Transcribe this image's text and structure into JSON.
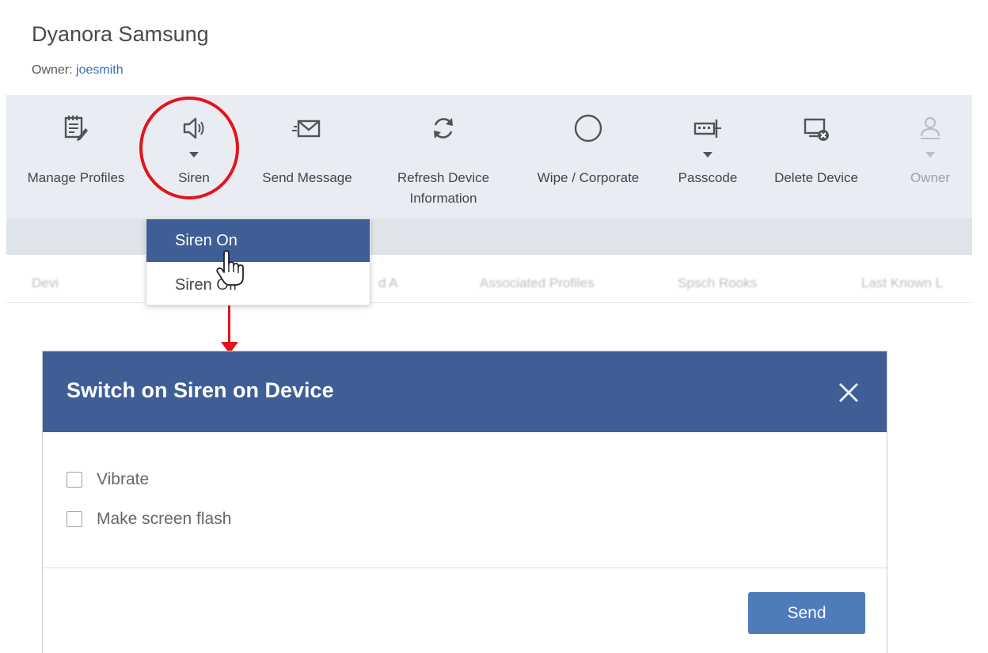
{
  "device": {
    "name": "Dyanora Samsung",
    "owner_prefix": "Owner: ",
    "owner_name": "joesmith"
  },
  "toolbar": [
    {
      "label": "Manage Profiles",
      "icon": "manage-profiles-icon",
      "has_dropdown": false
    },
    {
      "label": "Siren",
      "icon": "speaker-icon",
      "has_dropdown": true
    },
    {
      "label": "Send Message",
      "icon": "envelope-icon",
      "has_dropdown": false
    },
    {
      "label": "Refresh Device\nInformation",
      "icon": "refresh-icon",
      "has_dropdown": false
    },
    {
      "label": "Wipe / Corporate",
      "icon": "circle-icon",
      "has_dropdown": false
    },
    {
      "label": "Passcode",
      "icon": "passcode-icon",
      "has_dropdown": true
    },
    {
      "label": "Delete Device",
      "icon": "delete-device-icon",
      "has_dropdown": false
    },
    {
      "label": "Owner",
      "icon": "owner-icon",
      "has_dropdown": true,
      "disabled": true
    }
  ],
  "background_tabs": [
    "Devi",
    "d A",
    "Associated Profiles",
    "Spsch Rooks",
    "Last Known L"
  ],
  "siren_menu": {
    "items": [
      "Siren On",
      "Siren Off"
    ],
    "highlighted": "Siren On"
  },
  "dialog": {
    "title": "Switch on Siren on Device",
    "options": [
      {
        "label": "Vibrate",
        "checked": false
      },
      {
        "label": "Make screen flash",
        "checked": false
      }
    ],
    "send_label": "Send"
  },
  "colors": {
    "accent": "#3e5e95",
    "button": "#4f7bbb",
    "annotation": "#e3141b",
    "toolbar_bg": "#e9ecf2"
  }
}
